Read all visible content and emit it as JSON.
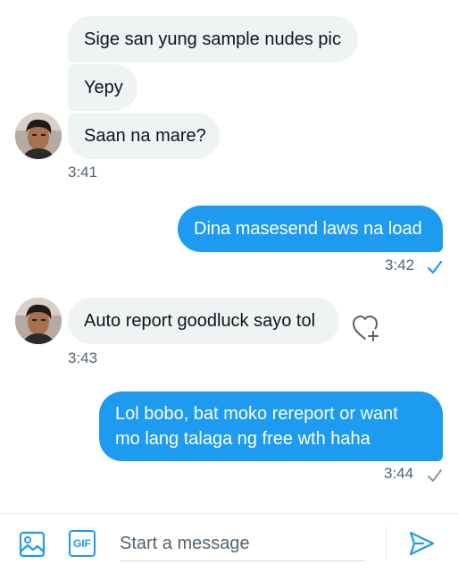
{
  "messages": {
    "m1": {
      "text": "Sige san yung sample nudes pic"
    },
    "m2": {
      "text": "Yepy"
    },
    "m3": {
      "text": "Saan na mare?"
    },
    "t1": {
      "time": "3:41"
    },
    "m4": {
      "text": "Dina masesend laws na load"
    },
    "t2": {
      "time": "3:42"
    },
    "m5": {
      "text": "Auto report goodluck sayo tol"
    },
    "t3": {
      "time": "3:43"
    },
    "m6": {
      "line1": "Lol bobo, bat moko rereport or want",
      "line2": "mo lang talaga ng free wth haha"
    },
    "t4": {
      "time": "3:44"
    }
  },
  "composer": {
    "placeholder": "Start a message",
    "gif_label": "GIF"
  },
  "icons": {
    "image": "image-icon",
    "gif": "gif-icon",
    "send": "send-icon",
    "react": "heart-plus-icon",
    "read": "check-icon"
  },
  "colors": {
    "accent": "#1d9bf0",
    "incoming_bubble": "#eff3f4",
    "timestamp": "#536471",
    "read_check": "#1d9bf0",
    "sent_check": "#8b98a5"
  }
}
